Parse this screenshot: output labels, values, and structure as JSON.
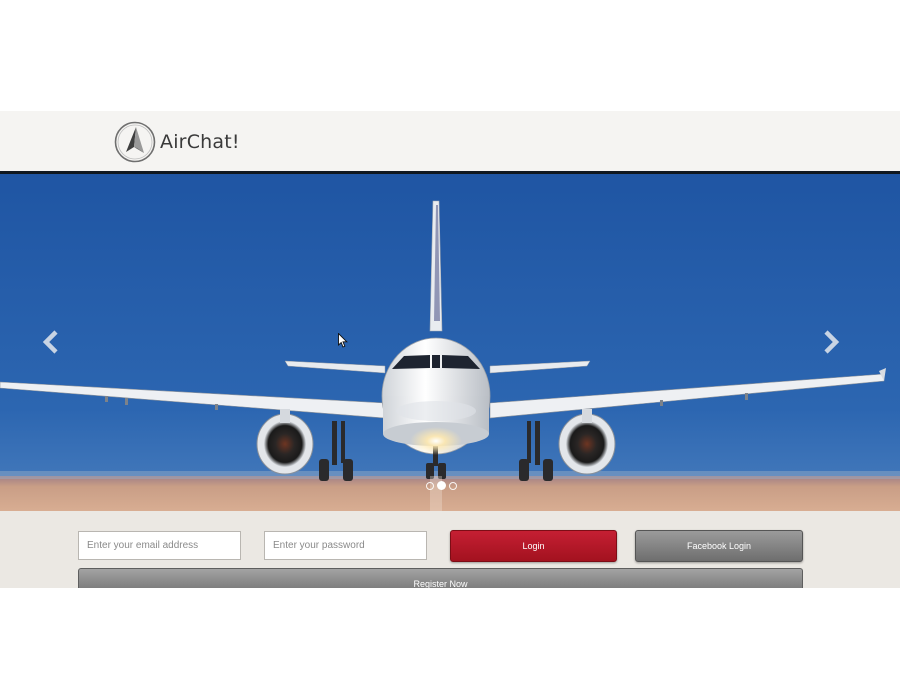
{
  "header": {
    "logo_text": "AirChat!"
  },
  "hero": {
    "prev_icon": "chevron-left-icon",
    "next_icon": "chevron-right-icon",
    "slides": 3,
    "active_slide": 2,
    "colors": {
      "sky": "#245aa6",
      "runway": "#c9a08a"
    }
  },
  "form": {
    "email_placeholder": "Enter your email address",
    "password_placeholder": "Enter your password",
    "login_label": "Login",
    "facebook_label": "Facebook Login",
    "register_label": "Register Now"
  },
  "colors": {
    "login_button": "#b0172a",
    "secondary_button": "#858585",
    "form_band": "#ebe8e3",
    "header_band": "#f5f4f2"
  }
}
